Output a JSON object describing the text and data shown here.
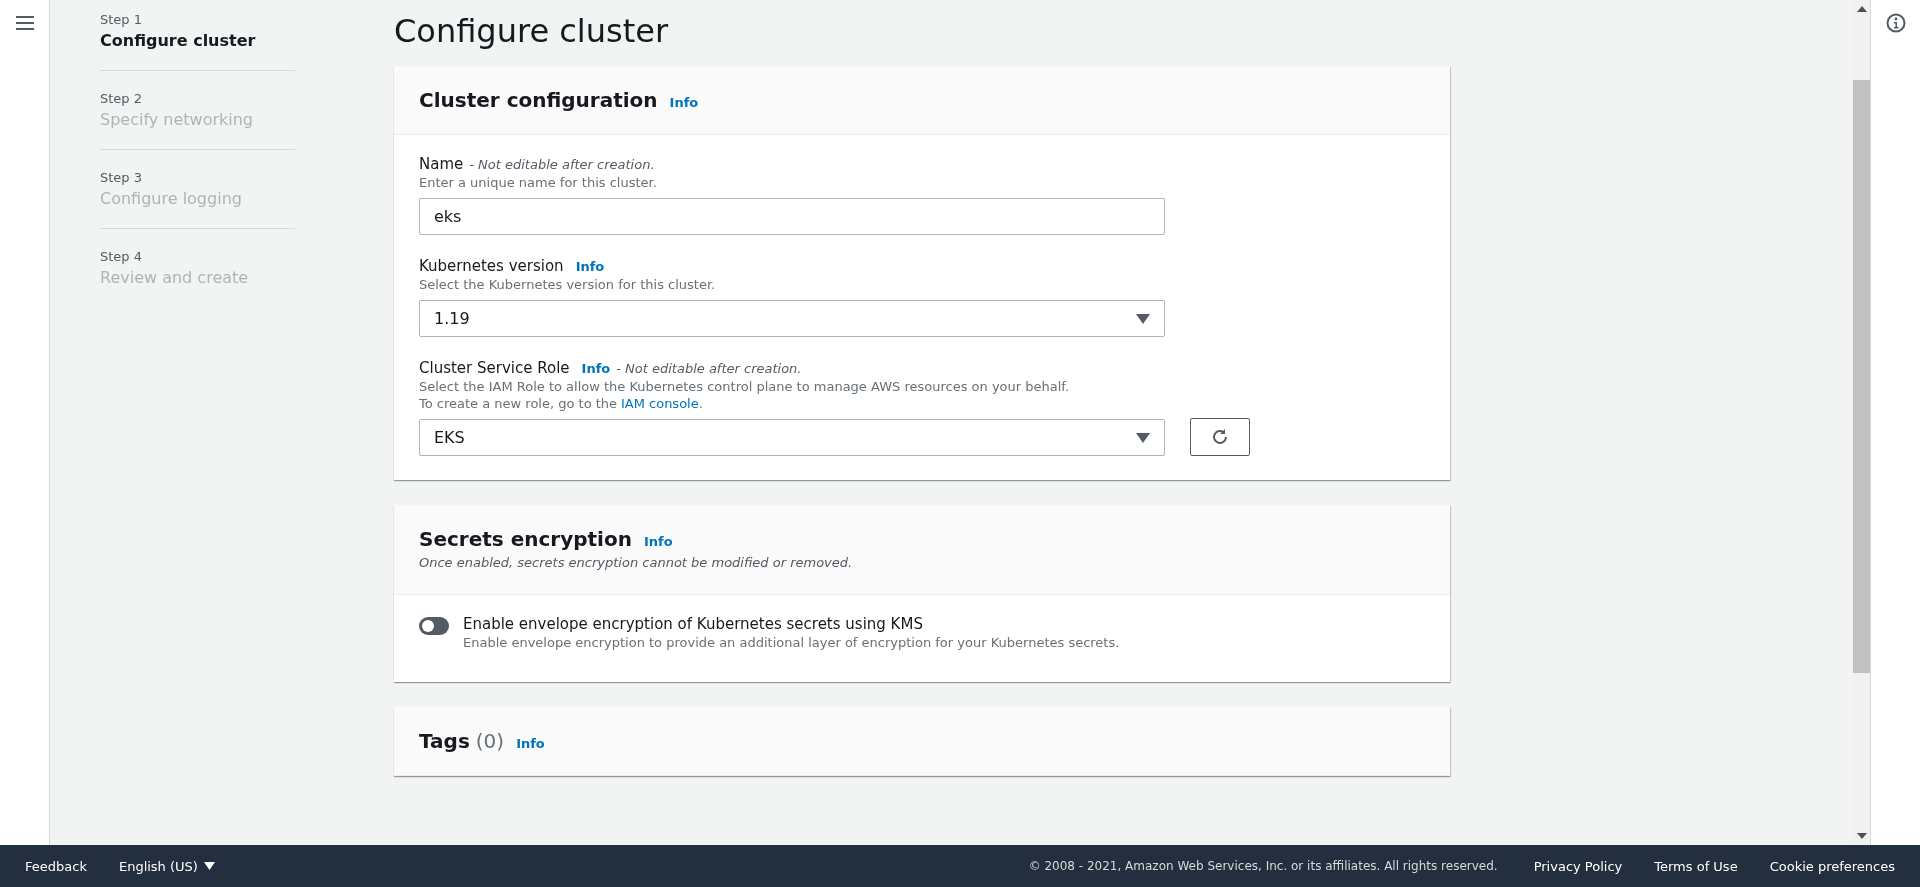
{
  "steps": [
    {
      "label": "Step 1",
      "title": "Configure cluster",
      "selected": true
    },
    {
      "label": "Step 2",
      "title": "Specify networking",
      "selected": false
    },
    {
      "label": "Step 3",
      "title": "Configure logging",
      "selected": false
    },
    {
      "label": "Step 4",
      "title": "Review and create",
      "selected": false
    }
  ],
  "page_title": "Configure cluster",
  "cluster_configuration": {
    "title": "Cluster configuration",
    "info": "Info",
    "name": {
      "label": "Name",
      "note": "- Not editable after creation.",
      "description": "Enter a unique name for this cluster.",
      "value": "eks"
    },
    "version": {
      "label": "Kubernetes version",
      "info": "Info",
      "description": "Select the Kubernetes version for this cluster.",
      "value": "1.19"
    },
    "role": {
      "label": "Cluster Service Role",
      "info": "Info",
      "note": "- Not editable after creation.",
      "description": "Select the IAM Role to allow the Kubernetes control plane to manage AWS resources on your behalf.",
      "description_2": "To create a new role, go to the",
      "link": "IAM console",
      "link_end": ".",
      "value": "EKS"
    }
  },
  "secrets_encryption": {
    "title": "Secrets encryption",
    "info": "Info",
    "description": "Once enabled, secrets encryption cannot be modified or removed.",
    "toggle": {
      "label": "Enable envelope encryption of Kubernetes secrets using KMS",
      "description": "Enable envelope encryption to provide an additional layer of encryption for your Kubernetes secrets.",
      "on": false
    }
  },
  "tags": {
    "title": "Tags",
    "count": "(0)",
    "info": "Info"
  },
  "footer": {
    "feedback": "Feedback",
    "language": "English (US)",
    "copyright": "© 2008 - 2021, Amazon Web Services, Inc. or its affiliates. All rights reserved.",
    "links": [
      "Privacy Policy",
      "Terms of Use",
      "Cookie preferences"
    ]
  }
}
